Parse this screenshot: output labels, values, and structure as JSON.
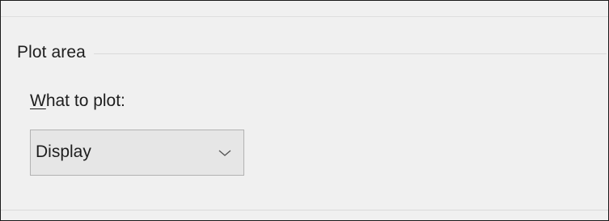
{
  "group": {
    "title": "Plot area"
  },
  "what_to_plot": {
    "label_mnemonic": "W",
    "label_rest": "hat to plot:",
    "selected": "Display",
    "arrow_icon": "chevron-down-icon"
  },
  "colors": {
    "panel_background": "#f0f0f0",
    "combo_background": "#e6e6e6",
    "combo_border": "#b2b2b2",
    "text": "#1e1e1e"
  }
}
